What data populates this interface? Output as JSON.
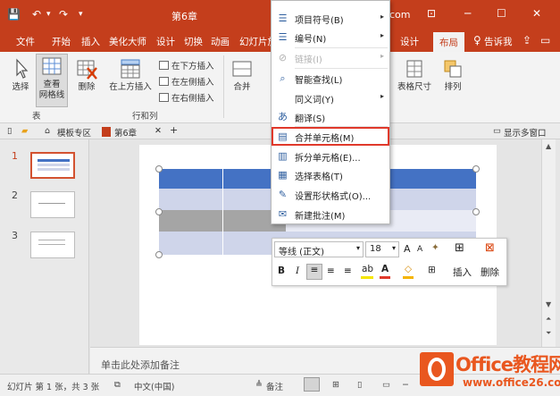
{
  "titlebar": {
    "doc_title": "第6章",
    "title_suffix": "com",
    "qa_save": "💾",
    "qa_undo": "↶",
    "qa_undo_drop": "▾",
    "qa_redo": "↷",
    "qa_custom": "▾",
    "win_options": "⊡",
    "win_min": "─",
    "win_max": "☐",
    "win_close": "✕"
  },
  "tabs": [
    "文件",
    "开始",
    "插入",
    "美化大师",
    "设计",
    "切换",
    "动画",
    "幻灯片放"
  ],
  "tabs_right": {
    "design": "设计",
    "layout": "布局",
    "tell_me": "告诉我"
  },
  "ribbon": {
    "select": "选择",
    "gridlines_1": "查看",
    "gridlines_2": "网格线",
    "delete": "删除",
    "insert_above": "在上方插入",
    "insert_below": "在下方插入",
    "insert_left": "在左侧插入",
    "insert_right": "在右侧插入",
    "merge": "合并",
    "table_size": "表格尺寸",
    "arrange": "排列",
    "group_table": "表",
    "group_rows_cols": "行和列"
  },
  "pane_strip": {
    "home": "⌂",
    "template": "模板专区",
    "doc_tab": "第6章",
    "close": "✕",
    "add": "+",
    "show_multi": "显示多窗口"
  },
  "slides": [
    {
      "num": "1",
      "selected": true
    },
    {
      "num": "2",
      "selected": false
    },
    {
      "num": "3",
      "selected": false
    }
  ],
  "context_menu": [
    {
      "icon": "☰",
      "label": "项目符号(B)",
      "arrow": "▸",
      "disabled": false
    },
    {
      "icon": "☰",
      "label": "编号(N)",
      "arrow": "▸",
      "disabled": false
    },
    {
      "icon": "⊘",
      "label": "链接(I)",
      "arrow": "▸",
      "disabled": true
    },
    {
      "icon": "⌕",
      "label": "智能查找(L)",
      "arrow": "",
      "disabled": false
    },
    {
      "icon": "",
      "label": "同义词(Y)",
      "arrow": "▸",
      "disabled": false
    },
    {
      "icon": "あ",
      "label": "翻译(S)",
      "arrow": "",
      "disabled": false
    },
    {
      "icon": "▤",
      "label": "合并单元格(M)",
      "arrow": "",
      "disabled": false,
      "highlight": true
    },
    {
      "icon": "▥",
      "label": "拆分单元格(E)...",
      "arrow": "",
      "disabled": false
    },
    {
      "icon": "▦",
      "label": "选择表格(T)",
      "arrow": "",
      "disabled": false
    },
    {
      "icon": "✎",
      "label": "设置形状格式(O)...",
      "arrow": "",
      "disabled": false
    },
    {
      "icon": "✉",
      "label": "新建批注(M)",
      "arrow": "",
      "disabled": false
    }
  ],
  "minibar": {
    "font": "等线 (正文)",
    "size": "18",
    "grow": "A",
    "shrink": "A",
    "bold": "B",
    "italic": "I",
    "insert": "插入",
    "delete": "删除"
  },
  "notes": "单击此处添加备注",
  "status": {
    "slide_info": "幻灯片 第 1 张，共 3 张",
    "language": "中文(中国)",
    "notes_btn": "备注"
  },
  "watermark": {
    "brand": "Office教程网",
    "url": "www.office26.com"
  },
  "colors": {
    "accent": "#c43e1c",
    "table_header": "#4472c4",
    "table_band_light": "#cfd5ea",
    "table_band_lighter": "#e9ebf5",
    "table_selected_row": "#a5a5a5",
    "highlight_box": "#e0392b"
  }
}
